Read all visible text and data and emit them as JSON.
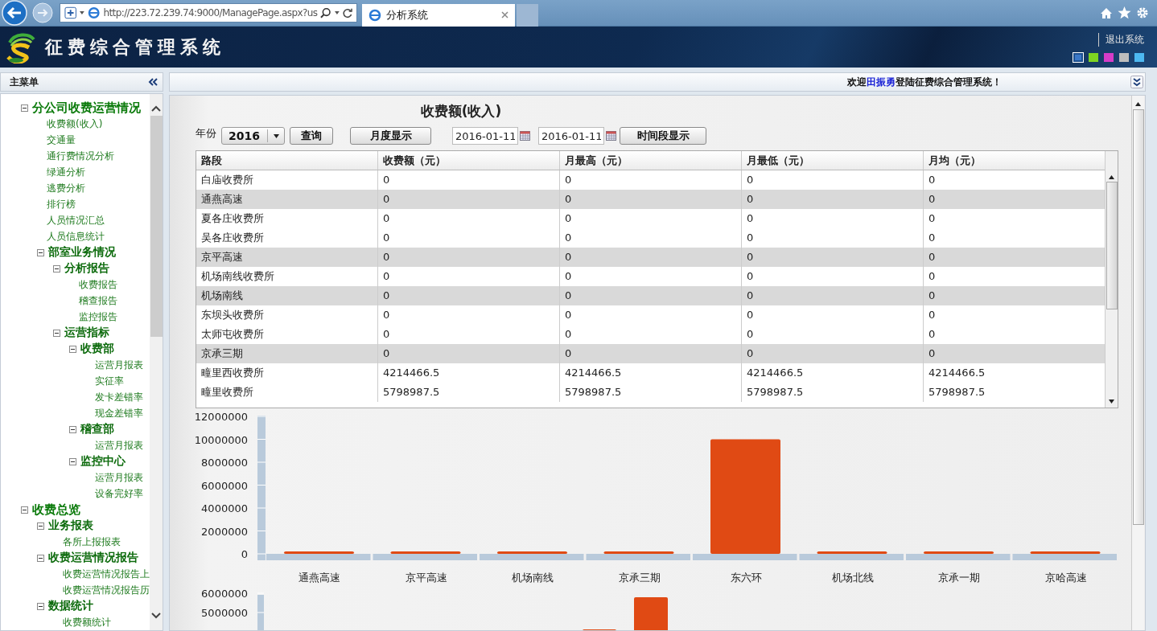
{
  "browser": {
    "url": "http://223.72.239.74:9000/ManagePage.aspx?us",
    "tab_title": "分析系统"
  },
  "header": {
    "title": "征费综合管理系统",
    "logout": "退出系统",
    "themes": [
      {
        "color": "#3b78c8",
        "selected": true
      },
      {
        "color": "#7ed321",
        "selected": false
      },
      {
        "color": "#d63cc8",
        "selected": false
      },
      {
        "color": "#bdbdbd",
        "selected": false
      },
      {
        "color": "#4db8f0",
        "selected": false
      }
    ]
  },
  "sidebar": {
    "title": "主菜单",
    "tree": [
      {
        "label": "分公司收费运营情况",
        "expanded": true,
        "children": [
          {
            "label": "收费额(收入)"
          },
          {
            "label": "交通量"
          },
          {
            "label": "通行费情况分析"
          },
          {
            "label": "绿通分析"
          },
          {
            "label": "逃费分析"
          },
          {
            "label": "排行榜"
          },
          {
            "label": "人员情况汇总"
          },
          {
            "label": "人员信息统计"
          },
          {
            "label": "部室业务情况",
            "expanded": true,
            "children": [
              {
                "label": "分析报告",
                "expanded": true,
                "children": [
                  {
                    "label": "收费报告"
                  },
                  {
                    "label": "稽查报告"
                  },
                  {
                    "label": "监控报告"
                  }
                ]
              },
              {
                "label": "运营指标",
                "expanded": true,
                "children": [
                  {
                    "label": "收费部",
                    "expanded": true,
                    "children": [
                      {
                        "label": "运营月报表"
                      },
                      {
                        "label": "实征率"
                      },
                      {
                        "label": "发卡差错率"
                      },
                      {
                        "label": "现金差错率"
                      }
                    ]
                  },
                  {
                    "label": "稽查部",
                    "expanded": true,
                    "children": [
                      {
                        "label": "运营月报表"
                      }
                    ]
                  },
                  {
                    "label": "监控中心",
                    "expanded": true,
                    "children": [
                      {
                        "label": "运营月报表"
                      },
                      {
                        "label": "设备完好率"
                      }
                    ]
                  }
                ]
              }
            ]
          }
        ]
      },
      {
        "label": "收费总览",
        "expanded": true,
        "children": [
          {
            "label": "业务报表",
            "expanded": true,
            "children": [
              {
                "label": "各所上报报表"
              }
            ]
          },
          {
            "label": "收费运营情况报告",
            "expanded": true,
            "children": [
              {
                "label": "收费运营情况报告上"
              },
              {
                "label": "收费运营情况报告历"
              }
            ]
          },
          {
            "label": "数据统计",
            "expanded": true,
            "children": [
              {
                "label": "收费额统计"
              }
            ]
          }
        ]
      }
    ]
  },
  "welcome": {
    "prefix": "欢迎",
    "user": "田振勇",
    "suffix": "登陆征费综合管理系统！"
  },
  "report": {
    "title": "收费额(收入)",
    "year_label": "年份",
    "year": "2016",
    "query_button": "查询",
    "monthly_button": "月度显示",
    "start_date": "2016-01-11",
    "end_date": "2016-01-11",
    "period_button": "时间段显示"
  },
  "table": {
    "columns": [
      "路段",
      "收费额（元）",
      "月最高（元）",
      "月最低（元）",
      "月均（元）"
    ],
    "rows": [
      {
        "kind": "station",
        "cells": [
          "白庙收费所",
          "0",
          "0",
          "0",
          "0"
        ]
      },
      {
        "kind": "road",
        "cells": [
          "通燕高速",
          "0",
          "0",
          "0",
          "0"
        ]
      },
      {
        "kind": "station",
        "cells": [
          "夏各庄收费所",
          "0",
          "0",
          "0",
          "0"
        ]
      },
      {
        "kind": "station",
        "cells": [
          "吴各庄收费所",
          "0",
          "0",
          "0",
          "0"
        ]
      },
      {
        "kind": "road",
        "cells": [
          "京平高速",
          "0",
          "0",
          "0",
          "0"
        ]
      },
      {
        "kind": "station",
        "cells": [
          "机场南线收费所",
          "0",
          "0",
          "0",
          "0"
        ]
      },
      {
        "kind": "road",
        "cells": [
          "机场南线",
          "0",
          "0",
          "0",
          "0"
        ]
      },
      {
        "kind": "station",
        "cells": [
          "东坝头收费所",
          "0",
          "0",
          "0",
          "0"
        ]
      },
      {
        "kind": "station",
        "cells": [
          "太师屯收费所",
          "0",
          "0",
          "0",
          "0"
        ]
      },
      {
        "kind": "road",
        "cells": [
          "京承三期",
          "0",
          "0",
          "0",
          "0"
        ]
      },
      {
        "kind": "station",
        "cells": [
          "疃里西收费所",
          "4214466.5",
          "4214466.5",
          "4214466.5",
          "4214466.5"
        ]
      },
      {
        "kind": "station",
        "cells": [
          "疃里收费所",
          "5798987.5",
          "5798987.5",
          "5798987.5",
          "5798987.5"
        ]
      }
    ]
  },
  "chart_1": {
    "chart_data": {
      "type": "bar",
      "categories": [
        "通燕高速",
        "京平高速",
        "机场南线",
        "京承三期",
        "东六环",
        "机场北线",
        "京承一期",
        "京哈高速"
      ],
      "series": [
        {
          "color": "#e04a14",
          "values": [
            0,
            0,
            0,
            0,
            10000000,
            0,
            0,
            0
          ]
        }
      ],
      "ylim": [
        0,
        12000000
      ],
      "yticks": [
        0,
        2000000,
        4000000,
        6000000,
        8000000,
        10000000,
        12000000
      ]
    }
  },
  "chart_2": {
    "axis_labels": [
      "6000000",
      "5000000"
    ]
  }
}
